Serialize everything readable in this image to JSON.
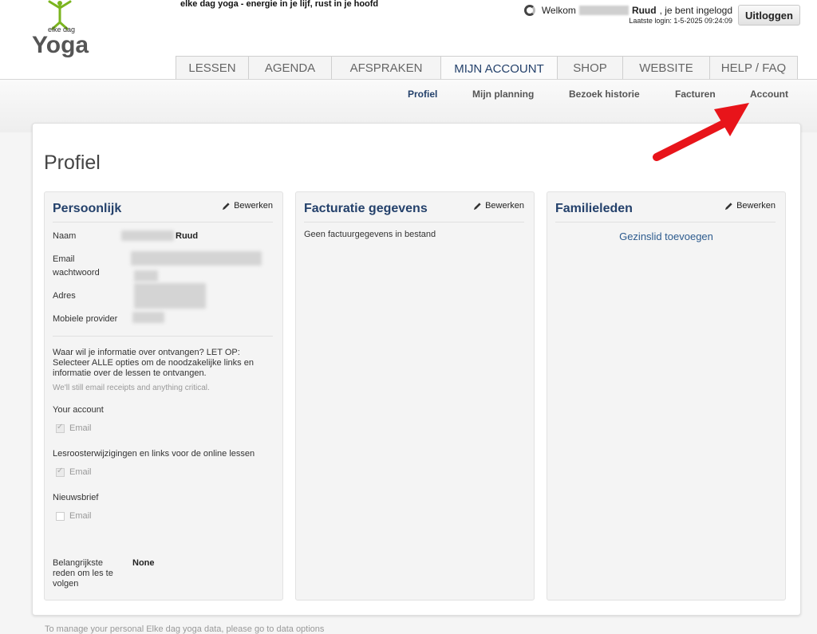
{
  "brand": {
    "logo_small": "elke dag",
    "logo_big": "Yoga",
    "tagline": "elke dag yoga - energie in je lijf, rust in je hoofd"
  },
  "user": {
    "welcome_prefix": "Welkom",
    "name_suffix": "Ruud",
    "logged_in": ", je bent ingelogd",
    "last_login": "Laatste login: 1-5-2025 09:24:09",
    "logout_label": "Uitloggen"
  },
  "tabs": [
    {
      "label": "LESSEN"
    },
    {
      "label": "AGENDA"
    },
    {
      "label": "AFSPRAKEN"
    },
    {
      "label": "MIJN ACCOUNT",
      "active": true
    },
    {
      "label": "SHOP"
    },
    {
      "label": "WEBSITE"
    },
    {
      "label": "HELP / FAQ"
    }
  ],
  "subnav": [
    {
      "label": "Profiel",
      "active": true
    },
    {
      "label": "Mijn planning"
    },
    {
      "label": "Bezoek historie"
    },
    {
      "label": "Facturen"
    },
    {
      "label": "Account"
    }
  ],
  "page_title": "Profiel",
  "edit_label": "Bewerken",
  "personal": {
    "title": "Persoonlijk",
    "name_label": "Naam",
    "name_value": "Ruud",
    "email_label": "Email",
    "password_label": "wachtwoord",
    "address_label": "Adres",
    "provider_label": "Mobiele provider",
    "info_question": "Waar wil je informatie over ontvangen? LET OP: Selecteer ALLE opties om de noodzakelijke links en informatie over de lessen te ontvangen.",
    "info_note": "We'll still email receipts and anything critical.",
    "sections": [
      {
        "label": "Your account",
        "option": "Email",
        "checked": true
      },
      {
        "label": "Lesroosterwijzigingen en links voor de online lessen",
        "option": "Email",
        "checked": true
      },
      {
        "label": "Nieuwsbrief",
        "option": "Email",
        "checked": false
      }
    ],
    "reason_label": "Belangrijkste reden om les te volgen",
    "reason_value": "None"
  },
  "billing": {
    "title": "Facturatie gegevens",
    "empty_text": "Geen factuurgegevens in bestand"
  },
  "family": {
    "title": "Familieleden",
    "add_link": "Gezinslid toevoegen"
  },
  "footer_note": "To manage your personal Elke dag yoga data, please go to data options",
  "colors": {
    "accent": "#24416b",
    "link": "#2d5b8e",
    "arrow": "#e8141a"
  }
}
